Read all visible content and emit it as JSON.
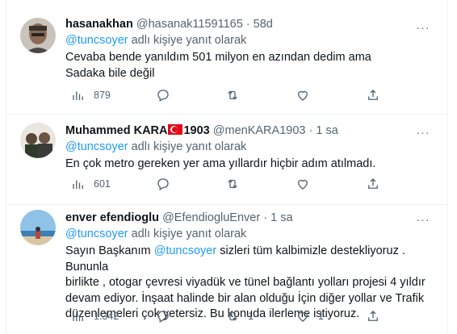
{
  "tweets": [
    {
      "name": "hasanakhan",
      "name_suffix": "",
      "handle": "@hasanak11591165",
      "time": "58d",
      "reply_mention": "@tuncsoyer",
      "reply_text": " adlı kişiye yanıt olarak",
      "text_lines": [
        "Cevaba bende yanıldım 501 milyon en azından dedim ama",
        "Sadaka bile değil"
      ],
      "views": "879",
      "likes": "",
      "retweets": ""
    },
    {
      "name": "Muhammed KARA",
      "name_suffix": "1903",
      "handle": "@menKARA1903",
      "time": "1 sa",
      "reply_mention": "@tuncsoyer",
      "reply_text": " adlı kişiye yanıt olarak",
      "text_lines": [
        "En çok metro gereken yer ama yıllardır hiçbir adım atılmadı."
      ],
      "views": "601",
      "likes": "",
      "retweets": ""
    },
    {
      "name": "enver efendioglu",
      "name_suffix": "",
      "handle": "@EfendiogluEnver",
      "time": "1 sa",
      "reply_mention": "@tuncsoyer",
      "reply_text": " adlı kişiye yanıt olarak",
      "text_prefix": "Sayın Başkanım ",
      "text_mention": "@tuncsoyer",
      "text_lines": [
        " sizleri tüm kalbimizle destekliyoruz . Bununla",
        "birlikte , otogar çevresi viyadük ve tünel bağlantı yolları projesi 4 yıldır",
        "devam ediyor. İnşaat halinde bir alan olduğu İçin diğer yollar ve Trafik",
        "düzenlemeleri çok yetersiz. Bu konuda ilerleme istiyoruz."
      ],
      "views": "1.342",
      "likes": "1",
      "retweets": "1"
    }
  ],
  "separator": "·",
  "more_label": "···",
  "icons": [
    "views-icon",
    "reply-icon",
    "retweet-icon",
    "like-icon",
    "share-icon",
    "turkey-flag-icon"
  ]
}
